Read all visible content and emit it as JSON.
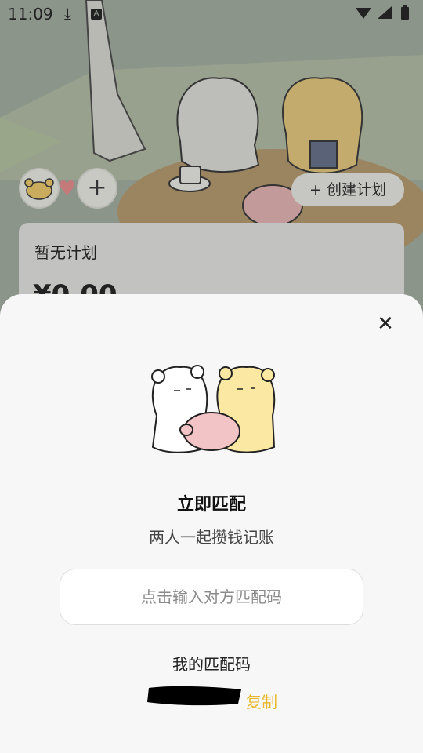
{
  "status_bar": {
    "time": "11:09",
    "download_icon": "download-icon",
    "app_icon_letter": "A",
    "right_icons": "▼◢ ▮"
  },
  "header": {
    "create_plan_label": "+ 创建计划",
    "add_partner_symbol": "+"
  },
  "plan_card": {
    "title": "暂无计划",
    "amount": "¥0.00"
  },
  "match_sheet": {
    "close_symbol": "✕",
    "title": "立即匹配",
    "subtitle": "两人一起攒钱记账",
    "code_input_placeholder": "点击输入对方匹配码",
    "my_code_label": "我的匹配码",
    "copy_label": "复制"
  },
  "colors": {
    "accent": "#e9b729",
    "sheet_bg": "#f7f7f7",
    "overlay_dim": "#7f8a80"
  }
}
